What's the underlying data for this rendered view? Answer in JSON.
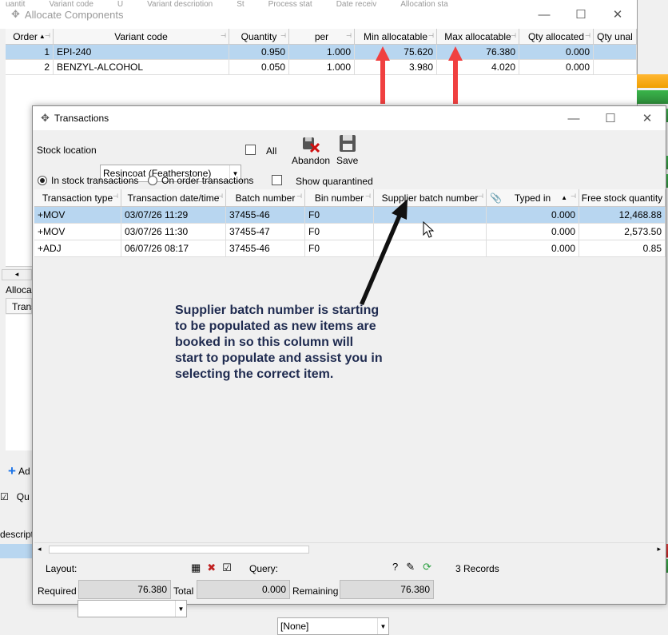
{
  "bg_window": {
    "title": "Allocate Components",
    "behind_header": [
      "uantit",
      "Variant code",
      "U",
      "Variant description",
      "St",
      "Process stat",
      "Date receiv",
      "Allocation sta"
    ],
    "grid": {
      "columns": [
        "Order",
        "Variant code",
        "Quantity",
        "per",
        "Min allocatable",
        "Max allocatable",
        "Qty allocated",
        "Qty unal"
      ],
      "rows": [
        {
          "order": "1",
          "variant": "EPI-240",
          "quantity": "0.950",
          "per": "1.000",
          "min": "75.620",
          "max": "76.380",
          "allocated": "0.000"
        },
        {
          "order": "2",
          "variant": "BENZYL-ALCOHOL",
          "quantity": "0.050",
          "per": "1.000",
          "min": "3.980",
          "max": "4.020",
          "allocated": "0.000"
        }
      ]
    },
    "left_fragments": {
      "alloca": "Alloca",
      "trans": "Trans",
      "add": "Ad",
      "qu": "Qu",
      "descripti": "descripti"
    },
    "status_colors": [
      "#2ea043",
      "#f0a000",
      "#2ea043",
      "#2ea043",
      "#2ea043",
      "#2ea043"
    ]
  },
  "dialog": {
    "title": "Transactions",
    "stock_location_label": "Stock location",
    "stock_location_value": "Resincoat (Featherstone)",
    "all_label": "All",
    "abandon_label": "Abandon",
    "save_label": "Save",
    "in_stock_label": "In stock transactions",
    "on_order_label": "On order transactions",
    "show_quarantined_label": "Show quarantined",
    "grid": {
      "columns": [
        "Transaction type",
        "Transaction date/time",
        "Batch number",
        "Bin number",
        "Supplier batch number",
        "Typed in",
        "Free stock quantity"
      ],
      "rows": [
        {
          "type": "+MOV",
          "datetime": "03/07/26 11:29",
          "batch": "37455-46",
          "bin": "F0",
          "supplier_batch": "",
          "typed_in": "0.000",
          "free_qty": "12,468.88"
        },
        {
          "type": "+MOV",
          "datetime": "03/07/26 11:30",
          "batch": "37455-47",
          "bin": "F0",
          "supplier_batch": "",
          "typed_in": "0.000",
          "free_qty": "2,573.50"
        },
        {
          "type": "+ADJ",
          "datetime": "06/07/26 08:17",
          "batch": "37455-46",
          "bin": "F0",
          "supplier_batch": "",
          "typed_in": "0.000",
          "free_qty": "0.85"
        }
      ]
    },
    "annotation_text": "Supplier batch number is starting to be populated as new items are booked in so this column will start to populate and assist you in selecting the correct item.",
    "footer": {
      "layout_label": "Layout:",
      "layout_value": "",
      "query_label": "Query:",
      "query_value": "[None]",
      "records": "3 Records",
      "required_label": "Required",
      "required_value": "76.380",
      "total_label": "Total",
      "total_value": "0.000",
      "remaining_label": "Remaining",
      "remaining_value": "76.380"
    }
  },
  "colors": {
    "selection": "#b8d6f0",
    "arrow_red": "#f04040",
    "annotation_text": "#1e2a4f"
  }
}
